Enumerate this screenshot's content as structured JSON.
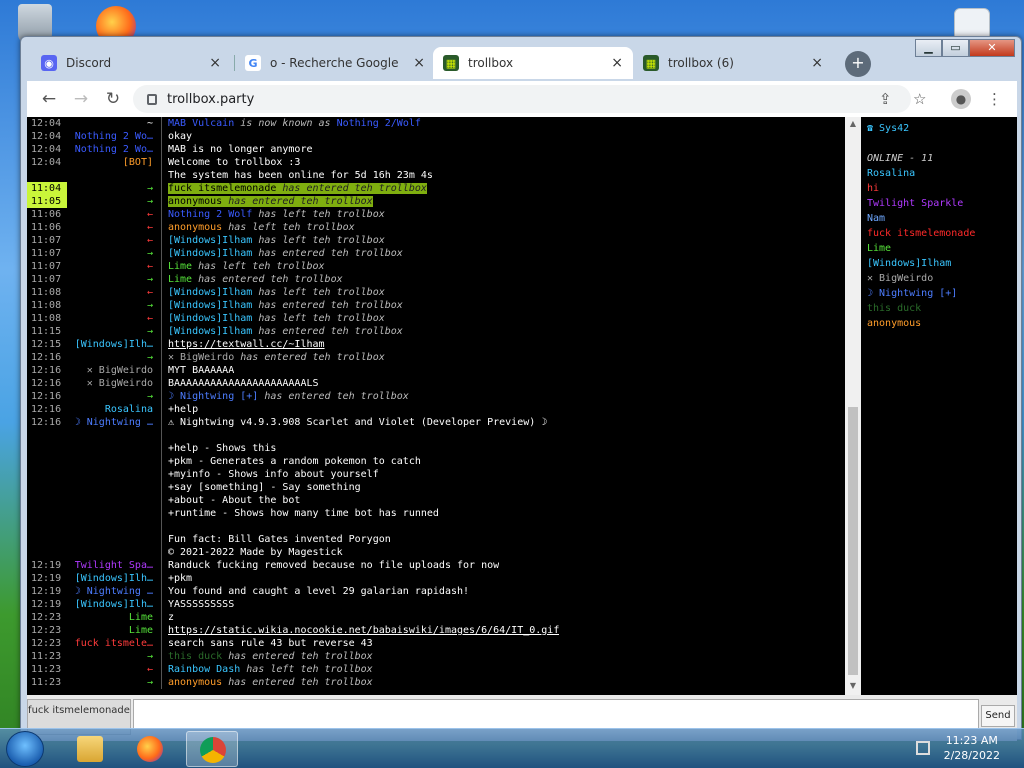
{
  "browser": {
    "tabs": [
      {
        "title": "Discord",
        "icon": "discord-icon",
        "active": false
      },
      {
        "title": "o - Recherche Google",
        "icon": "google-icon",
        "active": false
      },
      {
        "title": "trollbox",
        "icon": "trollbox-icon",
        "active": true
      },
      {
        "title": "trollbox (6)",
        "icon": "trollbox-icon",
        "active": false
      }
    ],
    "url": "trollbox.party",
    "close_glyph": "×",
    "newtab_glyph": "+"
  },
  "chat": {
    "messages": [
      {
        "time": "12:04",
        "nick": "~",
        "nick_color": "#ffffff",
        "text": "",
        "parts": [
          {
            "t": "MAB Vulcain",
            "c": "#3a5bff"
          },
          {
            "t": " is now known as ",
            "c": "#bbbbbb",
            "i": true
          },
          {
            "t": "Nothing 2/Wolf",
            "c": "#3a5bff"
          }
        ]
      },
      {
        "time": "12:04",
        "nick": "Nothing 2 Wo…",
        "nick_color": "#3a5bff",
        "parts": [
          {
            "t": "okay",
            "c": "#ffffff"
          }
        ]
      },
      {
        "time": "12:04",
        "nick": "Nothing 2 Wo…",
        "nick_color": "#3a5bff",
        "parts": [
          {
            "t": "MAB is no longer anymore",
            "c": "#ffffff"
          }
        ]
      },
      {
        "time": "12:04",
        "nick": "[BOT]",
        "nick_color": "#ff9d2a",
        "parts": [
          {
            "t": "Welcome to trollbox :3",
            "c": "#ffffff"
          }
        ]
      },
      {
        "time": "",
        "nick": "",
        "nick_color": "#ffffff",
        "parts": [
          {
            "t": "The system has been online for 5d 16h 23m 4s",
            "c": "#ffffff"
          }
        ]
      },
      {
        "time": "11:04",
        "nick": "→",
        "nick_color": "#56e33a",
        "hl": true,
        "parts": [
          {
            "t": "fuck itsmelemonade",
            "c": "#000000",
            "h": true
          },
          {
            "t": " has entered teh trollbox",
            "c": "#222222",
            "i": true,
            "h": true
          }
        ]
      },
      {
        "time": "11:05",
        "nick": "→",
        "nick_color": "#56e33a",
        "hl": true,
        "parts": [
          {
            "t": "anonymous",
            "c": "#000000",
            "h": true
          },
          {
            "t": " has entered teh trollbox",
            "c": "#222222",
            "i": true,
            "h": true
          }
        ]
      },
      {
        "time": "11:06",
        "nick": "←",
        "nick_color": "#ff3b3b",
        "parts": [
          {
            "t": "Nothing 2 Wolf",
            "c": "#3a5bff"
          },
          {
            "t": " has left teh trollbox",
            "c": "#bbbbbb",
            "i": true
          }
        ]
      },
      {
        "time": "11:06",
        "nick": "←",
        "nick_color": "#ff3b3b",
        "parts": [
          {
            "t": "anonymous",
            "c": "#ff9d2a"
          },
          {
            "t": " has left teh trollbox",
            "c": "#bbbbbb",
            "i": true
          }
        ]
      },
      {
        "time": "11:07",
        "nick": "←",
        "nick_color": "#ff3b3b",
        "parts": [
          {
            "t": "[Windows]Ilham",
            "c": "#3ac6ff"
          },
          {
            "t": " has left teh trollbox",
            "c": "#bbbbbb",
            "i": true
          }
        ]
      },
      {
        "time": "11:07",
        "nick": "→",
        "nick_color": "#56e33a",
        "parts": [
          {
            "t": "[Windows]Ilham",
            "c": "#3ac6ff"
          },
          {
            "t": " has entered teh trollbox",
            "c": "#bbbbbb",
            "i": true
          }
        ]
      },
      {
        "time": "11:07",
        "nick": "←",
        "nick_color": "#ff3b3b",
        "parts": [
          {
            "t": "Lime",
            "c": "#56e33a"
          },
          {
            "t": " has left teh trollbox",
            "c": "#bbbbbb",
            "i": true
          }
        ]
      },
      {
        "time": "11:07",
        "nick": "→",
        "nick_color": "#56e33a",
        "parts": [
          {
            "t": "Lime",
            "c": "#56e33a"
          },
          {
            "t": " has entered teh trollbox",
            "c": "#bbbbbb",
            "i": true
          }
        ]
      },
      {
        "time": "11:08",
        "nick": "←",
        "nick_color": "#ff3b3b",
        "parts": [
          {
            "t": "[Windows]Ilham",
            "c": "#3ac6ff"
          },
          {
            "t": " has left teh trollbox",
            "c": "#bbbbbb",
            "i": true
          }
        ]
      },
      {
        "time": "11:08",
        "nick": "→",
        "nick_color": "#56e33a",
        "parts": [
          {
            "t": "[Windows]Ilham",
            "c": "#3ac6ff"
          },
          {
            "t": " has entered teh trollbox",
            "c": "#bbbbbb",
            "i": true
          }
        ]
      },
      {
        "time": "11:08",
        "nick": "←",
        "nick_color": "#ff3b3b",
        "parts": [
          {
            "t": "[Windows]Ilham",
            "c": "#3ac6ff"
          },
          {
            "t": " has left teh trollbox",
            "c": "#bbbbbb",
            "i": true
          }
        ]
      },
      {
        "time": "11:15",
        "nick": "→",
        "nick_color": "#56e33a",
        "parts": [
          {
            "t": "[Windows]Ilham",
            "c": "#3ac6ff"
          },
          {
            "t": " has entered teh trollbox",
            "c": "#bbbbbb",
            "i": true
          }
        ]
      },
      {
        "time": "12:15",
        "nick": "[Windows]Ilh…",
        "nick_color": "#3ac6ff",
        "parts": [
          {
            "t": "https://textwall.cc/~Ilham",
            "c": "#ffffff",
            "u": true
          }
        ]
      },
      {
        "time": "12:16",
        "nick": "→",
        "nick_color": "#56e33a",
        "parts": [
          {
            "t": "✕ BigWeirdo",
            "c": "#aaaaaa"
          },
          {
            "t": " has entered teh trollbox",
            "c": "#bbbbbb",
            "i": true
          }
        ]
      },
      {
        "time": "12:16",
        "nick": "✕ BigWeirdo",
        "nick_color": "#aaaaaa",
        "parts": [
          {
            "t": "MYT BAAAAAA",
            "c": "#ffffff"
          }
        ]
      },
      {
        "time": "12:16",
        "nick": "✕ BigWeirdo",
        "nick_color": "#aaaaaa",
        "parts": [
          {
            "t": "BAAAAAAAAAAAAAAAAAAAAAALS",
            "c": "#ffffff"
          }
        ]
      },
      {
        "time": "12:16",
        "nick": "→",
        "nick_color": "#56e33a",
        "parts": [
          {
            "t": "☽ Nightwing [+]",
            "c": "#4d7dff"
          },
          {
            "t": " has entered teh trollbox",
            "c": "#bbbbbb",
            "i": true
          }
        ]
      },
      {
        "time": "12:16",
        "nick": "Rosalina",
        "nick_color": "#3ac6ff",
        "parts": [
          {
            "t": "+help",
            "c": "#ffffff"
          }
        ]
      },
      {
        "time": "12:16",
        "nick": "☽ Nightwing …",
        "nick_color": "#4d7dff",
        "parts": [
          {
            "t": "⚠ Nightwing v4.9.3.908 Scarlet and Violet (Developer Preview) ☽",
            "c": "#ffffff"
          }
        ]
      },
      {
        "time": "",
        "nick": "",
        "nick_color": "#ffffff",
        "parts": [
          {
            "t": "",
            "c": "#ffffff"
          }
        ]
      },
      {
        "time": "",
        "nick": "",
        "nick_color": "#ffffff",
        "parts": [
          {
            "t": "+help - Shows this",
            "c": "#ffffff"
          }
        ]
      },
      {
        "time": "",
        "nick": "",
        "nick_color": "#ffffff",
        "parts": [
          {
            "t": "+pkm - Generates a random pokemon to catch",
            "c": "#ffffff"
          }
        ]
      },
      {
        "time": "",
        "nick": "",
        "nick_color": "#ffffff",
        "parts": [
          {
            "t": "+myinfo - Shows info about yourself",
            "c": "#ffffff"
          }
        ]
      },
      {
        "time": "",
        "nick": "",
        "nick_color": "#ffffff",
        "parts": [
          {
            "t": "+say [something] - Say something",
            "c": "#ffffff"
          }
        ]
      },
      {
        "time": "",
        "nick": "",
        "nick_color": "#ffffff",
        "parts": [
          {
            "t": "+about - About the bot",
            "c": "#ffffff"
          }
        ]
      },
      {
        "time": "",
        "nick": "",
        "nick_color": "#ffffff",
        "parts": [
          {
            "t": "+runtime - Shows how many time bot has runned",
            "c": "#ffffff"
          }
        ]
      },
      {
        "time": "",
        "nick": "",
        "nick_color": "#ffffff",
        "parts": [
          {
            "t": "",
            "c": "#ffffff"
          }
        ]
      },
      {
        "time": "",
        "nick": "",
        "nick_color": "#ffffff",
        "parts": [
          {
            "t": "Fun fact: Bill Gates invented Porygon",
            "c": "#ffffff"
          }
        ]
      },
      {
        "time": "",
        "nick": "",
        "nick_color": "#ffffff",
        "parts": [
          {
            "t": "© 2021-2022 Made by Magestick",
            "c": "#ffffff"
          }
        ]
      },
      {
        "time": "12:19",
        "nick": "Twilight Spa…",
        "nick_color": "#b03aff",
        "parts": [
          {
            "t": "Randuck fucking removed because no file uploads for now",
            "c": "#ffffff"
          }
        ]
      },
      {
        "time": "12:19",
        "nick": "[Windows]Ilh…",
        "nick_color": "#3ac6ff",
        "parts": [
          {
            "t": "+pkm",
            "c": "#ffffff"
          }
        ]
      },
      {
        "time": "12:19",
        "nick": "☽ Nightwing …",
        "nick_color": "#4d7dff",
        "parts": [
          {
            "t": "You found and caught a level 29 galarian rapidash!",
            "c": "#ffffff"
          }
        ]
      },
      {
        "time": "12:19",
        "nick": "[Windows]Ilh…",
        "nick_color": "#3ac6ff",
        "parts": [
          {
            "t": "YASSSSSSSSS",
            "c": "#ffffff"
          }
        ]
      },
      {
        "time": "12:23",
        "nick": "Lime",
        "nick_color": "#56e33a",
        "parts": [
          {
            "t": "z",
            "c": "#ffffff"
          }
        ]
      },
      {
        "time": "12:23",
        "nick": "Lime",
        "nick_color": "#56e33a",
        "parts": [
          {
            "t": "https://static.wikia.nocookie.net/babaiswiki/images/6/64/IT_0.gif",
            "c": "#ffffff",
            "u": true
          }
        ]
      },
      {
        "time": "12:23",
        "nick": "fuck itsmele…",
        "nick_color": "#ff3b3b",
        "parts": [
          {
            "t": "search sans rule 43 but reverse 43",
            "c": "#ffffff"
          }
        ]
      },
      {
        "time": "11:23",
        "nick": "→",
        "nick_color": "#56e33a",
        "parts": [
          {
            "t": "this duck",
            "c": "#2a6b2a"
          },
          {
            "t": " has entered teh trollbox",
            "c": "#bbbbbb",
            "i": true
          }
        ]
      },
      {
        "time": "11:23",
        "nick": "←",
        "nick_color": "#ff3b3b",
        "parts": [
          {
            "t": "Rainbow Dash",
            "c": "#3ac6ff"
          },
          {
            "t": " has left teh trollbox",
            "c": "#bbbbbb",
            "i": true
          }
        ]
      },
      {
        "time": "11:23",
        "nick": "→",
        "nick_color": "#56e33a",
        "parts": [
          {
            "t": "anonymous",
            "c": "#ff9d2a"
          },
          {
            "t": " has entered teh trollbox",
            "c": "#bbbbbb",
            "i": true
          }
        ]
      }
    ]
  },
  "users": {
    "top": {
      "name": "☎ Sys42",
      "color": "#3ac6ff"
    },
    "online_label": "ONLINE - 11",
    "list": [
      {
        "name": "Rosalina",
        "color": "#3ac6ff"
      },
      {
        "name": "hi",
        "color": "#ff3b3b"
      },
      {
        "name": "Twilight Sparkle",
        "color": "#b03aff"
      },
      {
        "name": "Nam",
        "color": "#6fa8ff"
      },
      {
        "name": "fuck itsmelemonade",
        "color": "#ff2a2a"
      },
      {
        "name": "Lime",
        "color": "#56e33a"
      },
      {
        "name": "[Windows]Ilham",
        "color": "#3ac6ff"
      },
      {
        "name": "✕ BigWeirdo",
        "color": "#aaaaaa"
      },
      {
        "name": "☽ Nightwing [+]",
        "color": "#4d7dff"
      },
      {
        "name": "this duck",
        "color": "#2a6b2a"
      },
      {
        "name": "anonymous",
        "color": "#ff9d2a"
      }
    ]
  },
  "input": {
    "nick": "fuck itsmelemonade",
    "placeholder": "",
    "send_label": "Send"
  },
  "taskbar": {
    "time": "11:23 AM",
    "date": "2/28/2022"
  }
}
